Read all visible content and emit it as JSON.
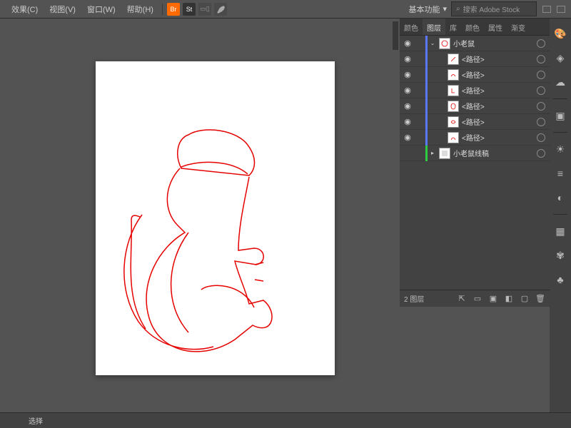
{
  "menu": {
    "effects": "效果(C)",
    "view": "视图(V)",
    "window": "窗口(W)",
    "help": "帮助(H)"
  },
  "toolbar_icons": {
    "br": "Br",
    "st": "St"
  },
  "workspace": {
    "label": "基本功能"
  },
  "search": {
    "placeholder": "搜索 Adobe Stock"
  },
  "panel": {
    "tabs": [
      "颜色",
      "图层",
      "库",
      "颜色",
      "属性",
      "渐变"
    ],
    "active_tab_index": 1,
    "layers": {
      "parent": "小老鼠",
      "path_label": "<路径>",
      "hidden_layer": "小老鼠线稿"
    },
    "footer": {
      "count": "2",
      "label": "图层"
    }
  },
  "status": {
    "text": "选择"
  }
}
